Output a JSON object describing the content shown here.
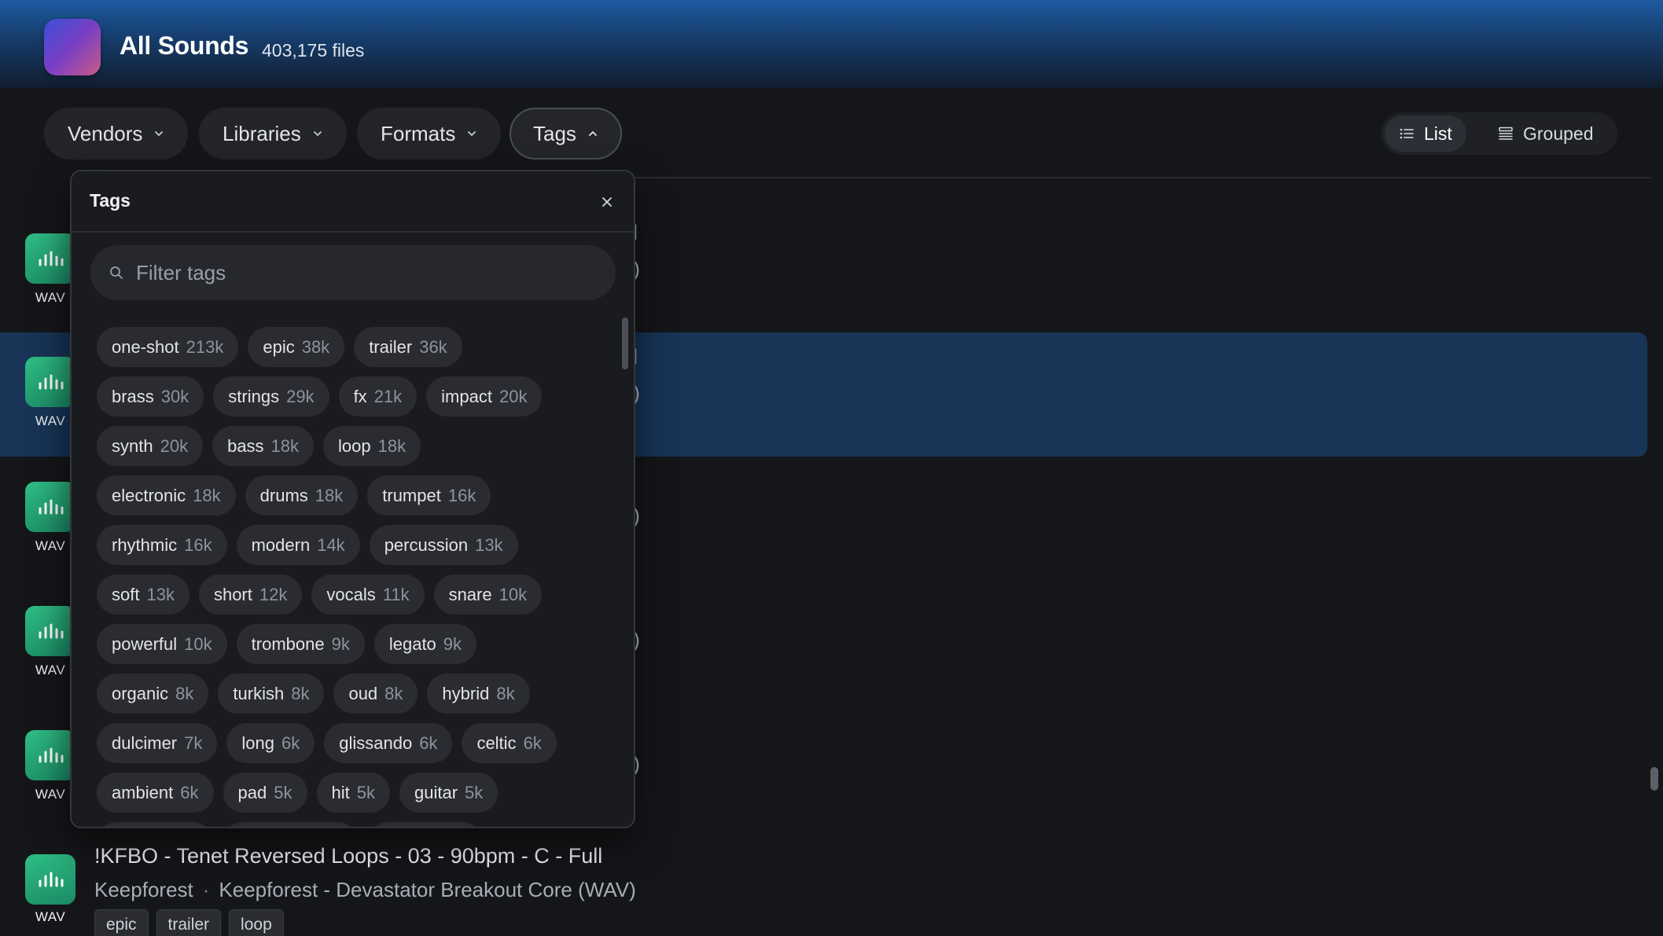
{
  "header": {
    "title": "All Sounds",
    "file_count": "403,175 files"
  },
  "filters": [
    {
      "label": "Vendors",
      "open": false
    },
    {
      "label": "Libraries",
      "open": false
    },
    {
      "label": "Formats",
      "open": false
    },
    {
      "label": "Tags",
      "open": true
    }
  ],
  "view_toggle": {
    "list_label": "List",
    "grouped_label": "Grouped",
    "selected": "List"
  },
  "tags_popover": {
    "title": "Tags",
    "search_placeholder": "Filter tags",
    "tags": [
      {
        "name": "one-shot",
        "count": "213k"
      },
      {
        "name": "epic",
        "count": "38k"
      },
      {
        "name": "trailer",
        "count": "36k"
      },
      {
        "name": "brass",
        "count": "30k"
      },
      {
        "name": "strings",
        "count": "29k"
      },
      {
        "name": "fx",
        "count": "21k"
      },
      {
        "name": "impact",
        "count": "20k"
      },
      {
        "name": "synth",
        "count": "20k"
      },
      {
        "name": "bass",
        "count": "18k"
      },
      {
        "name": "loop",
        "count": "18k"
      },
      {
        "name": "electronic",
        "count": "18k"
      },
      {
        "name": "drums",
        "count": "18k"
      },
      {
        "name": "trumpet",
        "count": "16k"
      },
      {
        "name": "rhythmic",
        "count": "16k"
      },
      {
        "name": "modern",
        "count": "14k"
      },
      {
        "name": "percussion",
        "count": "13k"
      },
      {
        "name": "soft",
        "count": "13k"
      },
      {
        "name": "short",
        "count": "12k"
      },
      {
        "name": "vocals",
        "count": "11k"
      },
      {
        "name": "snare",
        "count": "10k"
      },
      {
        "name": "powerful",
        "count": "10k"
      },
      {
        "name": "trombone",
        "count": "9k"
      },
      {
        "name": "legato",
        "count": "9k"
      },
      {
        "name": "organic",
        "count": "8k"
      },
      {
        "name": "turkish",
        "count": "8k"
      },
      {
        "name": "oud",
        "count": "8k"
      },
      {
        "name": "hybrid",
        "count": "8k"
      },
      {
        "name": "dulcimer",
        "count": "7k"
      },
      {
        "name": "long",
        "count": "6k"
      },
      {
        "name": "glissando",
        "count": "6k"
      },
      {
        "name": "celtic",
        "count": "6k"
      },
      {
        "name": "ambient",
        "count": "6k"
      },
      {
        "name": "pad",
        "count": "5k"
      },
      {
        "name": "hit",
        "count": "5k"
      },
      {
        "name": "guitar",
        "count": "5k"
      }
    ]
  },
  "sounds": [
    {
      "format": "WAV",
      "peek_title": "l",
      "peek_meta": ")"
    },
    {
      "format": "WAV",
      "peek_title": "l",
      "peek_meta": ")",
      "selected": true
    },
    {
      "format": "WAV",
      "peek_title": "",
      "peek_meta": ")"
    },
    {
      "format": "WAV",
      "peek_title": "",
      "peek_meta": ")"
    },
    {
      "format": "WAV",
      "peek_title": "",
      "peek_meta": ")"
    },
    {
      "format": "WAV",
      "title": "!KFBO - Tenet Reversed Loops - 03 - 90bpm - C - Full",
      "vendor": "Keepforest",
      "library": "Keepforest - Devastator Breakout Core (WAV)",
      "tags": [
        "epic",
        "trailer",
        "loop"
      ]
    }
  ],
  "colors": {
    "header_top": "#1d5aa0",
    "accent_green": "#2fbf86",
    "selected_row": "#183456",
    "background": "#151619"
  }
}
